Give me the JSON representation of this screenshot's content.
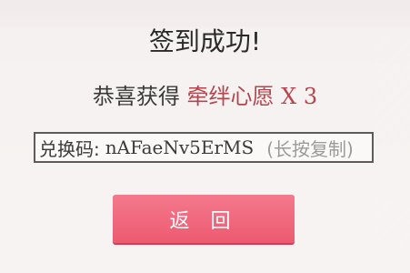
{
  "dialog": {
    "title": "签到成功!",
    "reward": {
      "prefix": "恭喜获得",
      "item": "牵绊心愿",
      "quantity": "X 3"
    },
    "code": {
      "label": "兑换码:",
      "value": "nAFaeNv5ErMS",
      "hint": "(长按复制)"
    },
    "back_label": "返 回"
  },
  "colors": {
    "accent": "#b2464f",
    "button": "#ec5a70"
  }
}
